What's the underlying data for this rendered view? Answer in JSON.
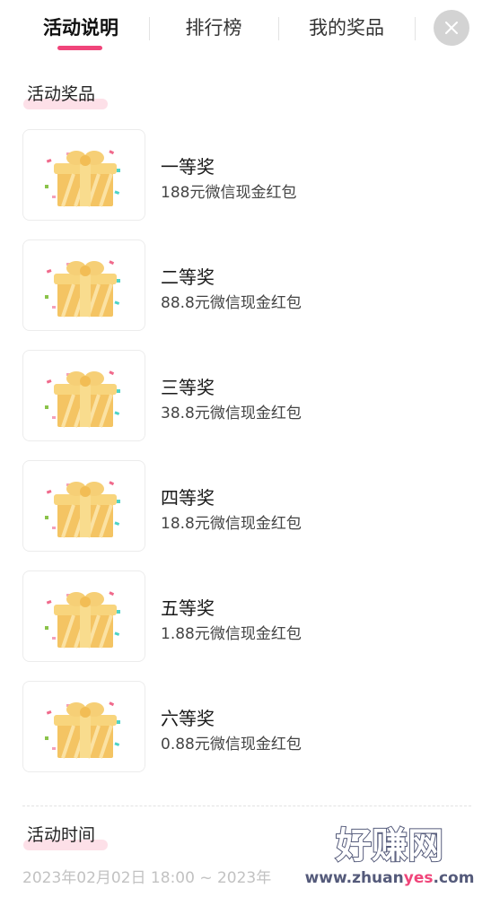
{
  "tabs": [
    {
      "label": "活动说明",
      "active": true
    },
    {
      "label": "排行榜",
      "active": false
    },
    {
      "label": "我的奖品",
      "active": false
    }
  ],
  "close_icon": "close-icon",
  "sections": {
    "prizes_title": "活动奖品",
    "time_title": "活动时间"
  },
  "prizes": [
    {
      "name": "一等奖",
      "desc": "188元微信现金红包",
      "icon": "gift-box-icon"
    },
    {
      "name": "二等奖",
      "desc": "88.8元微信现金红包",
      "icon": "gift-box-icon"
    },
    {
      "name": "三等奖",
      "desc": "38.8元微信现金红包",
      "icon": "gift-box-icon"
    },
    {
      "name": "四等奖",
      "desc": "18.8元微信现金红包",
      "icon": "gift-box-icon"
    },
    {
      "name": "五等奖",
      "desc": "1.88元微信现金红包",
      "icon": "gift-box-icon"
    },
    {
      "name": "六等奖",
      "desc": "0.88元微信现金红包",
      "icon": "gift-box-icon"
    }
  ],
  "activity_time": "2023年02月02日 18:00 ~ 2023年",
  "watermark": {
    "title": "好赚网",
    "domain_prefix": "www.zhuan",
    "domain_highlight": "yes",
    "domain_suffix": ".com"
  },
  "colors": {
    "accent": "#f0457a",
    "section_highlight": "#fde0e8",
    "gift_gold": "#f4c463",
    "watermark": "#545a7a"
  }
}
